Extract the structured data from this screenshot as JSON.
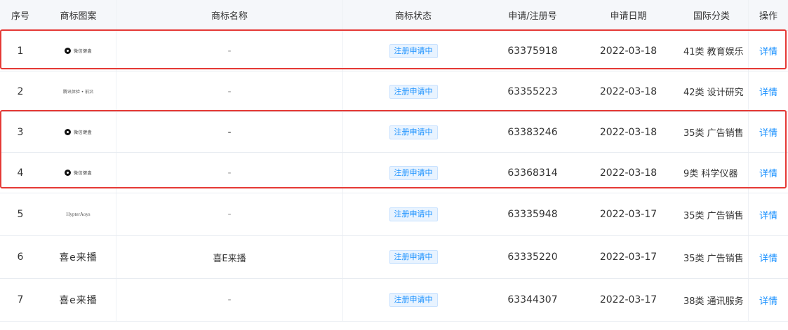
{
  "header": {
    "no": "序号",
    "image": "商标图案",
    "name": "商标名称",
    "status": "商标状态",
    "reg_no": "申请/注册号",
    "date": "申请日期",
    "class": "国际分类",
    "op": "操作"
  },
  "rows": [
    {
      "no": "1",
      "logo_text": "微信键盘",
      "name": "-",
      "status": "注册申请中",
      "reg_no": "63375918",
      "date": "2022-03-18",
      "class": "41类 教育娱乐",
      "op": "详情"
    },
    {
      "no": "2",
      "logo_text": "腾讯体验 • 前沿",
      "name": "-",
      "status": "注册申请中",
      "reg_no": "63355223",
      "date": "2022-03-18",
      "class": "42类 设计研究",
      "op": "详情"
    },
    {
      "no": "3",
      "logo_text": "微信键盘",
      "name": "-",
      "status": "注册申请中",
      "reg_no": "63383246",
      "date": "2022-03-18",
      "class": "35类 广告销售",
      "op": "详情"
    },
    {
      "no": "4",
      "logo_text": "微信键盘",
      "name": "-",
      "status": "注册申请中",
      "reg_no": "63368314",
      "date": "2022-03-18",
      "class": "9类 科学仪器",
      "op": "详情"
    },
    {
      "no": "5",
      "logo_text": "HypterAoys",
      "name": "-",
      "status": "注册申请中",
      "reg_no": "63335948",
      "date": "2022-03-17",
      "class": "35类 广告销售",
      "op": "详情"
    },
    {
      "no": "6",
      "logo_text": "喜e来播",
      "name": "喜E来播",
      "status": "注册申请中",
      "reg_no": "63335220",
      "date": "2022-03-17",
      "class": "35类 广告销售",
      "op": "详情"
    },
    {
      "no": "7",
      "logo_text": "喜e来播",
      "name": "-",
      "status": "注册申请中",
      "reg_no": "63344307",
      "date": "2022-03-17",
      "class": "38类 通讯服务",
      "op": "详情"
    }
  ],
  "colors": {
    "accent": "#1890ff",
    "highlight": "#e53935",
    "header_bg": "#f5f7fa"
  }
}
